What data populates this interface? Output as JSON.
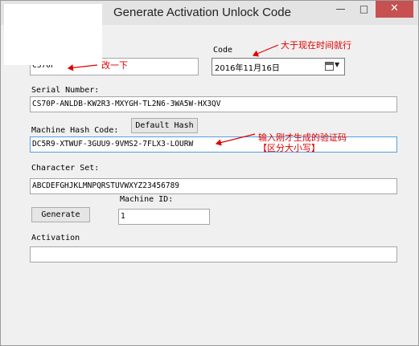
{
  "window": {
    "title": "Generate Activation Unlock Code",
    "minimize_glyph": "—",
    "maximize_glyph": "□",
    "close_glyph": "✕"
  },
  "product_field": {
    "value": "CS70P"
  },
  "code": {
    "label": "Code",
    "date_value": "2016年11月16日",
    "calendar_icon": "calendar-icon",
    "dropdown_glyph": "▼"
  },
  "serial": {
    "label": "Serial Number:",
    "value": "CS70P-ANLDB-KW2R3-MXYGH-TL2N6-3WA5W-HX3QV"
  },
  "machine_hash": {
    "label": "Machine Hash Code:",
    "value": "DC5R9-XTWUF-3GUU9-9VMS2-7FLX3-LOURW"
  },
  "default_hash_button": {
    "label": "Default Hash"
  },
  "character_set": {
    "label": "Character Set:",
    "value": "ABCDEFGHJKLMNPQRSTUVWXYZ23456789"
  },
  "generate_button": {
    "label": "Generate"
  },
  "machine_id": {
    "label": "Machine ID:",
    "value": "1"
  },
  "activation": {
    "label": "Activation",
    "value": ""
  },
  "annotations": {
    "change_note": "改一下",
    "date_note": "大于现在时间就行",
    "hash_note_line1": "输入刚才生成的验证码",
    "hash_note_line2": "【区分大小写】",
    "color": "#e00000"
  }
}
